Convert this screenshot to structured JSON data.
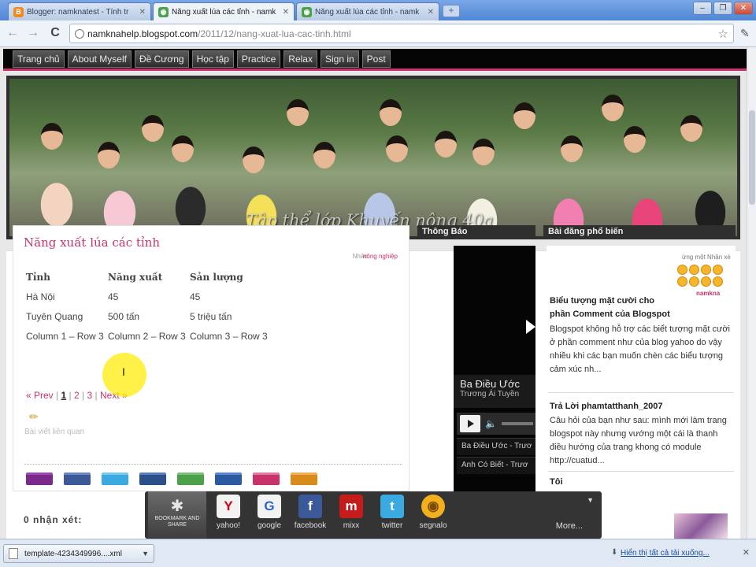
{
  "tabs": [
    {
      "label": "Blogger: namknatest - Tính tr",
      "active": false,
      "favicon_color": "#f08a24",
      "favicon": "B"
    },
    {
      "label": "Năng xuất lúa các tỉnh - namk",
      "active": true,
      "favicon_color": "#4aa14a",
      "favicon": "◉"
    },
    {
      "label": "Năng xuất lúa các tỉnh - namk",
      "active": false,
      "favicon_color": "#4aa14a",
      "favicon": "◉"
    }
  ],
  "window_buttons": {
    "minimize": "–",
    "maximize": "❐",
    "close": "✕"
  },
  "toolbar": {
    "back_icon": "←",
    "forward_icon": "→",
    "reload_icon": "C",
    "url_host": "namknahelp.blogspot.com",
    "url_path": "/2011/12/nang-xuat-lua-cac-tinh.html",
    "star_icon": "☆",
    "wrench_icon": "🔧"
  },
  "blog_nav": [
    "Trang chủ",
    "About Myself",
    "Đề Cương",
    "Học tập",
    "Practice",
    "Relax",
    "Sign in",
    "Post"
  ],
  "header": {
    "caption": "Tập thể lớp Khuyến nông 40a"
  },
  "post": {
    "title": "Năng xuất lúa các tỉnh",
    "label_prefix": "Nhãn:",
    "label": "nông nghiệp",
    "table": {
      "headers": [
        "Tỉnh",
        "Năng xuất",
        "Sản lượng"
      ],
      "rows": [
        [
          "Hà Nội",
          "45",
          "45"
        ],
        [
          "Tuyên Quang",
          "500 tấn",
          "5 triệu tấn"
        ],
        [
          "Column 1 – Row 3",
          "Column 2 – Row 3",
          "Column 3 – Row 3"
        ]
      ]
    },
    "pager": {
      "prev": "« Prev",
      "pages": [
        "1",
        "2",
        "3"
      ],
      "current": "1",
      "next": "Next »",
      "sep": "|"
    },
    "related": "Bài viết liên quan",
    "comments": "0 nhận xét:"
  },
  "widget_mid": {
    "title": "Thông Báo",
    "video_title": "Ba Điều Ước",
    "video_artist": "Trương Ái Tuyền",
    "playlist": [
      "Ba Điều Ước - Trươ",
      "Anh Có Biết - Trươ"
    ]
  },
  "widget_right": {
    "title": "Bài đăng phổ biến",
    "items": [
      {
        "title": "Biểu tượng mặt cười cho phần Comment của Blogspot",
        "body": "Blogspot không hỗ trợ các biểt tượng mặt cười ở phần comment như của blog yahoo do vậy nhiều khi các bạn muốn chèn các biểu tượng cảm xúc nh..."
      },
      {
        "title": "Trả Lời phamtatthanh_2007",
        "body": "Câu hỏi của bạn như sau: mình mới làm trang blogspot này nhưng vướng một cái là thanh điều hướng của trang khong có module http://cuatud..."
      },
      {
        "title": "Tôi",
        "body": ""
      }
    ],
    "emoticon_caption": "ừng một Nhận xé",
    "emoticon_name": "namkna"
  },
  "share_popup": {
    "main_label": "BOOKMARK AND SHARE",
    "services": [
      {
        "name": "yahoo!",
        "glyph": "Y",
        "color": "#f2f2f2",
        "text_color": "#d0021b"
      },
      {
        "name": "google",
        "glyph": "G",
        "color": "#f2f2f2",
        "text_color": "#2a64c9"
      },
      {
        "name": "facebook",
        "glyph": "f",
        "color": "#3b5998",
        "text_color": "#ffffff"
      },
      {
        "name": "mixx",
        "glyph": "m",
        "color": "#c51b1b",
        "text_color": "#ffffff"
      },
      {
        "name": "twitter",
        "glyph": "t",
        "color": "#3aaae1",
        "text_color": "#ffffff"
      },
      {
        "name": "segnalo",
        "glyph": "◉",
        "color": "#f2b01e",
        "text_color": "#7a4b00"
      }
    ],
    "more": "More...",
    "arrow": "▼"
  },
  "download_bar": {
    "file": "template-4234349996....xml",
    "show_all": "Hiển thị tất cả tải xuống...",
    "close": "✕"
  },
  "colors": {
    "accent": "#c8336e",
    "nav_bg": "#050505",
    "widget_title_bg": "#2f2f2f"
  }
}
